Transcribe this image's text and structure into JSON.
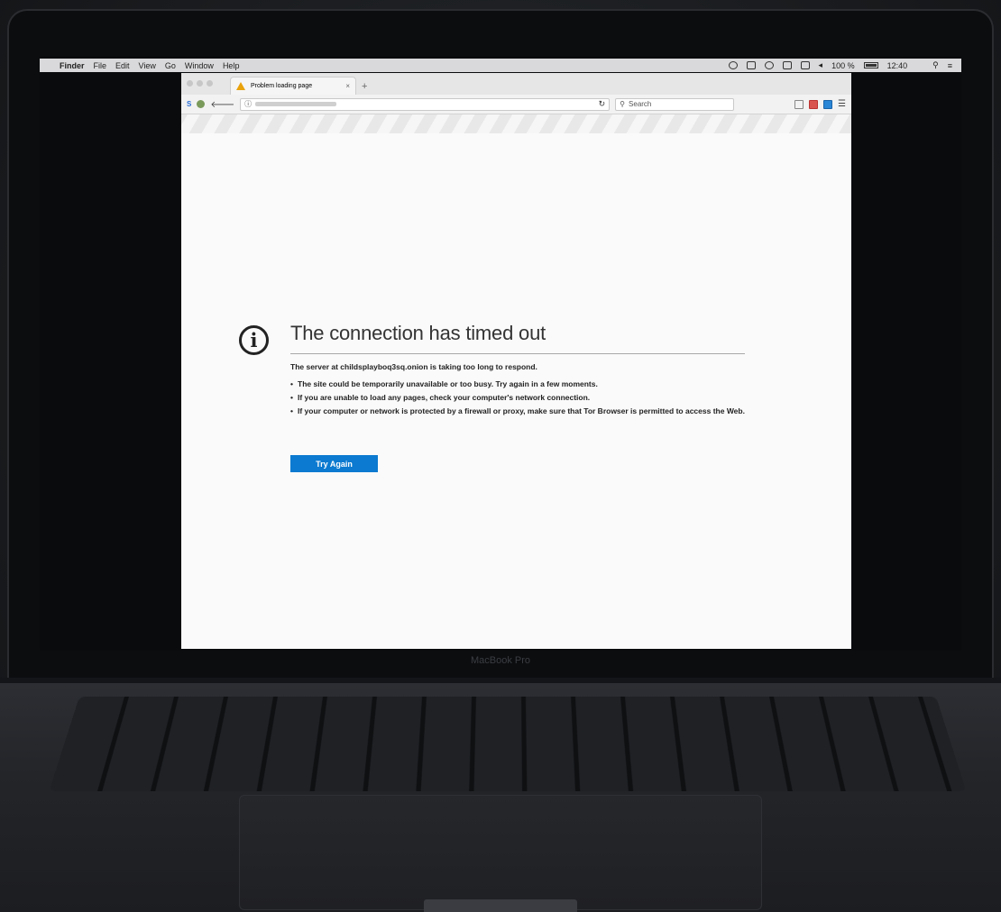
{
  "menubar": {
    "app": "Finder",
    "items": [
      "File",
      "Edit",
      "View",
      "Go",
      "Window",
      "Help"
    ],
    "battery": "100 %",
    "clock": "12:40"
  },
  "browser": {
    "tab_title": "Problem loading page",
    "tab_close": "×",
    "new_tab": "+",
    "search_placeholder": "Search"
  },
  "error": {
    "title": "The connection has timed out",
    "lead": "The server at childsplayboq3sq.onion is taking too long to respond.",
    "bullets": [
      "The site could be temporarily unavailable or too busy. Try again in a few moments.",
      "If you are unable to load any pages, check your computer's network connection.",
      "If your computer or network is protected by a firewall or proxy, make sure that Tor Browser is permitted to access the Web."
    ],
    "button": "Try Again"
  },
  "laptop": {
    "brand": "MacBook Pro"
  },
  "colors": {
    "accent_button": "#0b7ad0",
    "warning": "#e8a20c"
  }
}
